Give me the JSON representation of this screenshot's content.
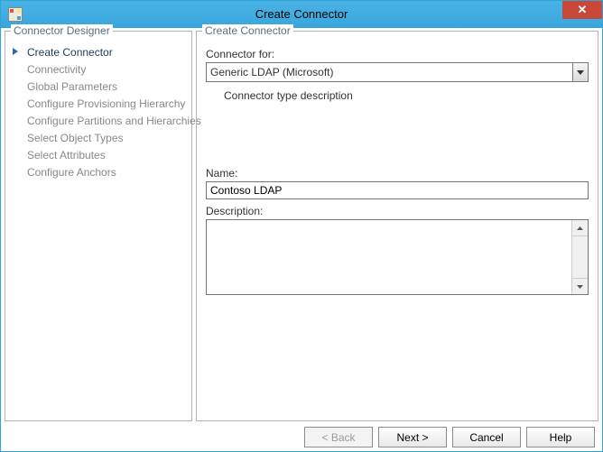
{
  "window": {
    "title": "Create Connector"
  },
  "left": {
    "legend": "Connector Designer",
    "items": [
      {
        "label": "Create Connector",
        "active": true
      },
      {
        "label": "Connectivity"
      },
      {
        "label": "Global Parameters"
      },
      {
        "label": "Configure Provisioning Hierarchy"
      },
      {
        "label": "Configure Partitions and Hierarchies"
      },
      {
        "label": "Select Object Types"
      },
      {
        "label": "Select Attributes"
      },
      {
        "label": "Configure Anchors"
      }
    ]
  },
  "right": {
    "legend": "Create Connector",
    "connector_for_label": "Connector for:",
    "connector_for_value": "Generic LDAP (Microsoft)",
    "type_desc_label": "Connector type description",
    "name_label": "Name:",
    "name_value": "Contoso LDAP",
    "description_label": "Description:",
    "description_value": ""
  },
  "buttons": {
    "back": "<  Back",
    "next": "Next  >",
    "cancel": "Cancel",
    "help": "Help"
  }
}
